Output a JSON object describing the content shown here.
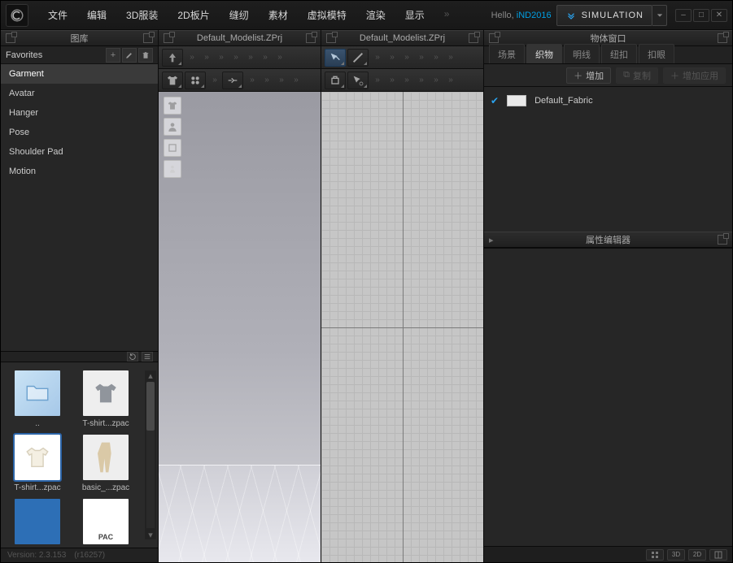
{
  "menu": {
    "items": [
      "文件",
      "编辑",
      "3D服装",
      "2D板片",
      "缝纫",
      "素材",
      "虚拟模特",
      "渲染",
      "显示"
    ]
  },
  "hello": {
    "prefix": "Hello, ",
    "user": "iND2016"
  },
  "simulation": {
    "label": "SIMULATION"
  },
  "library": {
    "title": "图库",
    "favorites": "Favorites",
    "categories": [
      "Garment",
      "Avatar",
      "Hanger",
      "Pose",
      "Shoulder Pad",
      "Motion"
    ],
    "selected": "Garment",
    "thumbs": [
      {
        "label": "..",
        "kind": "folder"
      },
      {
        "label": "T-shirt...zpac",
        "kind": "tee-grey"
      },
      {
        "label": "T-shirt...zpac",
        "kind": "tee-white",
        "selected": true
      },
      {
        "label": "basic_...zpac",
        "kind": "pants"
      },
      {
        "label": "",
        "kind": "swatch-blue"
      },
      {
        "label": "",
        "kind": "pac"
      }
    ]
  },
  "version": {
    "ver": "Version: 2.3.153",
    "rev": "(r16257)"
  },
  "viewport3d": {
    "title": "Default_Modelist.ZPrj"
  },
  "viewport2d": {
    "title": "Default_Modelist.ZPrj"
  },
  "objpanel": {
    "title": "物体窗口",
    "tabs": [
      "场景",
      "织物",
      "明线",
      "纽扣",
      "扣眼"
    ],
    "selectedTab": "织物",
    "buttons": {
      "add": "增加",
      "copy": "复制",
      "addApply": "增加应用"
    },
    "items": [
      {
        "name": "Default_Fabric"
      }
    ]
  },
  "propeditor": {
    "title": "属性编辑器"
  },
  "status": {
    "btns": [
      "",
      "3D",
      "2D",
      ""
    ]
  }
}
